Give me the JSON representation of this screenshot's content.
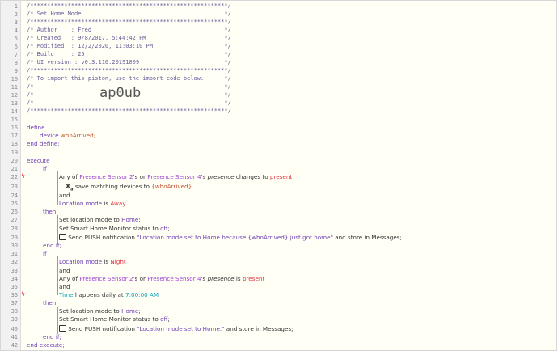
{
  "header_lines": [
    "/**********************************************************/",
    "/* Set Home Mode                                          */",
    "/**********************************************************/",
    "/* Author    : Fred                                       */",
    "/* Created   : 9/8/2017, 5:44:42 PM                       */",
    "/* Modified  : 12/2/2020, 11:03:10 PM                     */",
    "/* Build     : 25                                         */",
    "/* UI version : v0.3.110.20191009                         */",
    "/**********************************************************/",
    "/* To import this piston, use the import code below:      */",
    "/*                                                        */",
    "/*                                                        */",
    "/*                                                        */",
    "/**********************************************************/"
  ],
  "import_code": "ap0ub",
  "keywords": {
    "define": "define",
    "device": "device",
    "end_define": "end define;",
    "execute": "execute",
    "if": "if",
    "then": "then",
    "end_if": "end if;",
    "and": "and",
    "end_execute": "end execute;"
  },
  "variables": {
    "who_arrived": "whoArrived;"
  },
  "condition1": {
    "any_of": "Any of",
    "dev1": "Presence Sensor 2",
    "poss_or": "'s or",
    "dev2": "Presence Sensor 4",
    "poss": "'s",
    "attr": "presence",
    "op": "changes to",
    "value": "present",
    "save_text": "save matching devices to",
    "save_var": "{whoArrived}",
    "loc_label": "Location mode",
    "is": "is",
    "loc_value": "Away"
  },
  "actions1": {
    "set_mode_prefix": "Set location mode to",
    "set_mode_value": "Home",
    "shm_prefix": "Set Smart Home Monitor status to",
    "shm_value": "off",
    "push_prefix": "Send PUSH notification",
    "push_msg": "\"Location mode set to Home because {whoArrived} just got home\"",
    "push_suffix": "and store in Messages;"
  },
  "condition2": {
    "loc_label": "Location mode",
    "is": "is",
    "loc_value": "Night",
    "any_of": "Any of",
    "dev1": "Presence Sensor 2",
    "poss_or": "'s or",
    "dev2": "Presence Sensor 4",
    "poss": "'s",
    "attr": "presence",
    "is2": "is",
    "value": "present",
    "time_label": "Time",
    "happens": "happens daily at",
    "time_value": "7:00:00 AM"
  },
  "actions2": {
    "set_mode_prefix": "Set location mode to",
    "set_mode_value": "Home",
    "shm_prefix": "Set Smart Home Monitor status to",
    "shm_value": "off",
    "push_prefix": "Send PUSH notification",
    "push_msg": "\"Location mode set to Home.\"",
    "push_suffix": "and store in Messages;"
  },
  "line_numbers": [
    "1",
    "2",
    "3",
    "4",
    "5",
    "6",
    "7",
    "8",
    "9",
    "10",
    "11",
    "12",
    "13",
    "14",
    "15",
    "16",
    "17",
    "18",
    "19",
    "20",
    "21",
    "22",
    "23",
    "24",
    "25",
    "26",
    "27",
    "28",
    "29",
    "30",
    "31",
    "32",
    "33",
    "34",
    "35",
    "36",
    "37",
    "38",
    "39",
    "40",
    "41",
    "42"
  ],
  "colors": {
    "keyword": "#6d3fb5",
    "device": "#9b3fd1",
    "value": "#e0313c",
    "variable": "#c8542e",
    "time": "#0aa3b5",
    "fold": "#d2691e"
  }
}
